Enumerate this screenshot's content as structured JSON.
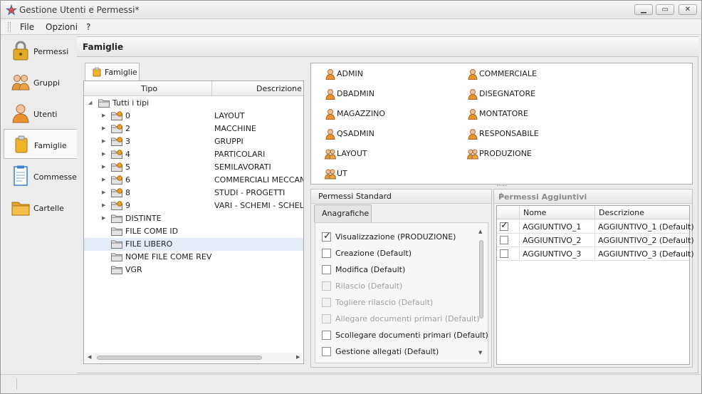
{
  "window": {
    "title": "Gestione Utenti e Permessi*",
    "buttons": {
      "minimize": "▁",
      "maximize": "▭",
      "close": "✕"
    }
  },
  "menu": [
    "File",
    "Opzioni",
    "?"
  ],
  "nav": [
    {
      "label": "Permessi",
      "icon": "lock-icon"
    },
    {
      "label": "Gruppi",
      "icon": "group-icon"
    },
    {
      "label": "Utenti",
      "icon": "user-icon"
    },
    {
      "label": "Famiglie",
      "icon": "families-icon"
    },
    {
      "label": "Commesse",
      "icon": "document-icon"
    },
    {
      "label": "Cartelle",
      "icon": "folder-icon"
    }
  ],
  "content": {
    "header": "Famiglie",
    "tab": "Famiglie",
    "tree": {
      "columns": {
        "tipo": "Tipo",
        "descrizione": "Descrizione"
      },
      "root": "Tutti i tipi",
      "rows": [
        {
          "tipo": "0",
          "descr": "LAYOUT",
          "expandable": "▶"
        },
        {
          "tipo": "2",
          "descr": "MACCHINE",
          "expandable": "▶"
        },
        {
          "tipo": "3",
          "descr": "GRUPPI",
          "expandable": "▶"
        },
        {
          "tipo": "4",
          "descr": "PARTICOLARI",
          "expandable": "▶"
        },
        {
          "tipo": "5",
          "descr": "SEMILAVORATI",
          "expandable": "▶"
        },
        {
          "tipo": "6",
          "descr": "COMMERCIALI MECCANICI",
          "expandable": "▶"
        },
        {
          "tipo": "8",
          "descr": "STUDI - PROGETTI",
          "expandable": "▶"
        },
        {
          "tipo": "9",
          "descr": "VARI - SCHEMI - SCHELETRI",
          "expandable": "▶"
        },
        {
          "tipo": "DISTINTE",
          "descr": "",
          "expandable": "▶"
        },
        {
          "tipo": "FILE COME ID",
          "descr": "",
          "expandable": ""
        },
        {
          "tipo": "FILE LIBERO",
          "descr": "",
          "expandable": ""
        },
        {
          "tipo": "NOME FILE COME REV",
          "descr": "",
          "expandable": ""
        },
        {
          "tipo": "VGR",
          "descr": "",
          "expandable": ""
        }
      ]
    }
  },
  "users": [
    {
      "label": "ADMIN",
      "type": "user"
    },
    {
      "label": "DBADMIN",
      "type": "user"
    },
    {
      "label": "MAGAZZINO",
      "type": "user"
    },
    {
      "label": "QSADMIN",
      "type": "user"
    },
    {
      "label": "LAYOUT",
      "type": "group"
    },
    {
      "label": "UT",
      "type": "group"
    },
    {
      "label": "COMMERCIALE",
      "type": "user"
    },
    {
      "label": "DISEGNATORE",
      "type": "user"
    },
    {
      "label": "MONTATORE",
      "type": "user"
    },
    {
      "label": "RESPONSABILE",
      "type": "user"
    },
    {
      "label": "PRODUZIONE",
      "type": "group"
    }
  ],
  "permessi_standard": {
    "title": "Permessi Standard",
    "tab": "Anagrafiche",
    "items": [
      {
        "label": "Visualizzazione (PRODUZIONE)",
        "checked": true,
        "enabled": true
      },
      {
        "label": "Creazione (Default)",
        "checked": false,
        "enabled": true
      },
      {
        "label": "Modifica (Default)",
        "checked": false,
        "enabled": true
      },
      {
        "label": "Rilascio (Default)",
        "checked": false,
        "enabled": false
      },
      {
        "label": "Togliere rilascio (Default)",
        "checked": false,
        "enabled": false
      },
      {
        "label": "Allegare documenti primari (Default)",
        "checked": false,
        "enabled": false
      },
      {
        "label": "Scollegare documenti primari (Default)",
        "checked": false,
        "enabled": true
      },
      {
        "label": "Gestione allegati (Default)",
        "checked": false,
        "enabled": true
      }
    ]
  },
  "permessi_aggiuntivi": {
    "title": "Permessi Aggiuntivi",
    "columns": {
      "nome": "Nome",
      "descrizione": "Descrizione"
    },
    "rows": [
      {
        "nome": "AGGIUNTIVO_1",
        "descr": "AGGIUNTIVO_1 (Default)",
        "checked": true
      },
      {
        "nome": "AGGIUNTIVO_2",
        "descr": "AGGIUNTIVO_2 (Default)",
        "checked": false
      },
      {
        "nome": "AGGIUNTIVO_3",
        "descr": "AGGIUNTIVO_3 (Default)",
        "checked": false
      }
    ]
  },
  "glyphs": {
    "check": "✓",
    "expanded": "◢",
    "pin": "⊥",
    "left": "◀",
    "right": "▶",
    "up": "▲",
    "down": "▼"
  }
}
